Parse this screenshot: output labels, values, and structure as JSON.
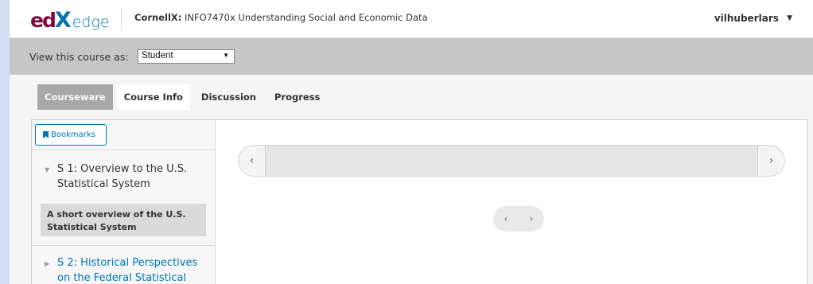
{
  "header": {
    "logo_ed": "ed",
    "logo_x": "X",
    "logo_edge": "edge",
    "course_org": "CornellX:",
    "course_title": "INFO7470x Understanding Social and Economic Data",
    "username": "vilhuberlars",
    "caret": "▼"
  },
  "viewbar": {
    "label": "View this course as:",
    "selected": "Student",
    "arrow": "▼"
  },
  "tabs": [
    {
      "label": "Courseware"
    },
    {
      "label": "Course Info"
    },
    {
      "label": "Discussion"
    },
    {
      "label": "Progress"
    }
  ],
  "sidebar": {
    "bookmarks_label": "Bookmarks",
    "sections": [
      {
        "line1": "S 1: Overview to the U.S.",
        "line2": "Statistical System",
        "tri": "▼"
      },
      {
        "line1": "S 2: Historical Perspectives",
        "line2": "on the Federal Statistical",
        "tri": "▶"
      }
    ],
    "subsection": {
      "line1": "A short overview of the U.S.",
      "line2": "Statistical System"
    }
  },
  "sequence": {
    "prev_glyph": "‹",
    "next_glyph": "›"
  },
  "colors": {
    "brand_blue": "#0075b4",
    "brand_maroon": "#7d0a3a",
    "active_tab": "#a8a8a8"
  }
}
